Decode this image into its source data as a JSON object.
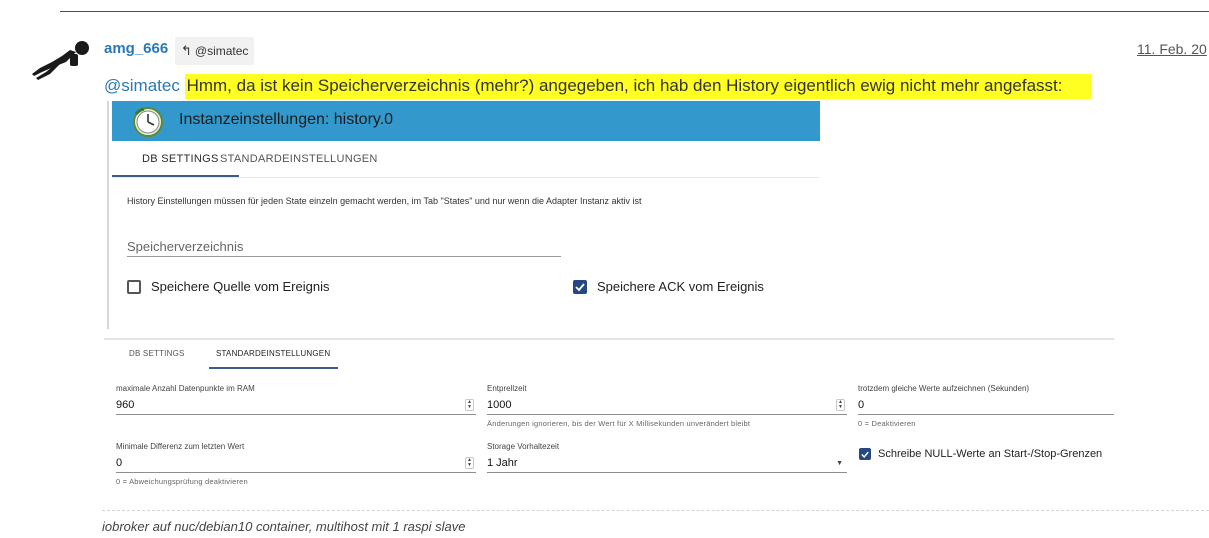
{
  "post": {
    "username": "amg_666",
    "reply_to": "@simatec",
    "date": "11. Feb. 20",
    "mention": "@simatec",
    "text": "Hmm, da ist kein Speicherverzeichnis (mehr?) angegeben, ich hab den History eigentlich ewig nicht mehr angefasst:",
    "highlight_color": "#ffff22",
    "signature": "iobroker auf nuc/debian10 container, multihost mit 1 raspi slave"
  },
  "screenshot_upper": {
    "title": "Instanzeinstellungen: history.0",
    "header_color": "#3399cc",
    "tabs": [
      "DB SETTINGS",
      "STANDARDEINSTELLUNGEN"
    ],
    "active_tab": "DB SETTINGS",
    "info": "History Einstellungen müssen für jeden State einzeln gemacht werden, im Tab \"States\" und nur wenn die Adapter Instanz aktiv ist",
    "storage_placeholder": "Speicherverzeichnis",
    "checkbox_source": {
      "label": "Speichere Quelle vom Ereignis",
      "checked": false
    },
    "checkbox_ack": {
      "label": "Speichere ACK vom Ereignis",
      "checked": true
    }
  },
  "screenshot_lower": {
    "tabs": [
      "DB SETTINGS",
      "STANDARDEINSTELLUNGEN"
    ],
    "active_tab": "STANDARDEINSTELLUNGEN",
    "fields": {
      "max_ram": {
        "label": "maximale Anzahl Datenpunkte im RAM",
        "value": "960"
      },
      "debounce": {
        "label": "Entprellzeit",
        "value": "1000",
        "help": "Änderungen ignorieren, bis der Wert für X Millisekunden unverändert bleibt"
      },
      "same_values": {
        "label": "trotzdem gleiche Werte aufzeichnen (Sekunden)",
        "value": "0",
        "help": "0 = Deaktivieren"
      },
      "min_diff": {
        "label": "Minimale Differenz zum letzten Wert",
        "value": "0",
        "help": "0 = Abweichungsprüfung deaktivieren"
      },
      "retention": {
        "label": "Storage Vorhaltezeit",
        "value": "1 Jahr"
      }
    },
    "null_values": {
      "label": "Schreibe NULL-Werte an Start-/Stop-Grenzen",
      "checked": true
    },
    "accent_color": "#24487f"
  }
}
